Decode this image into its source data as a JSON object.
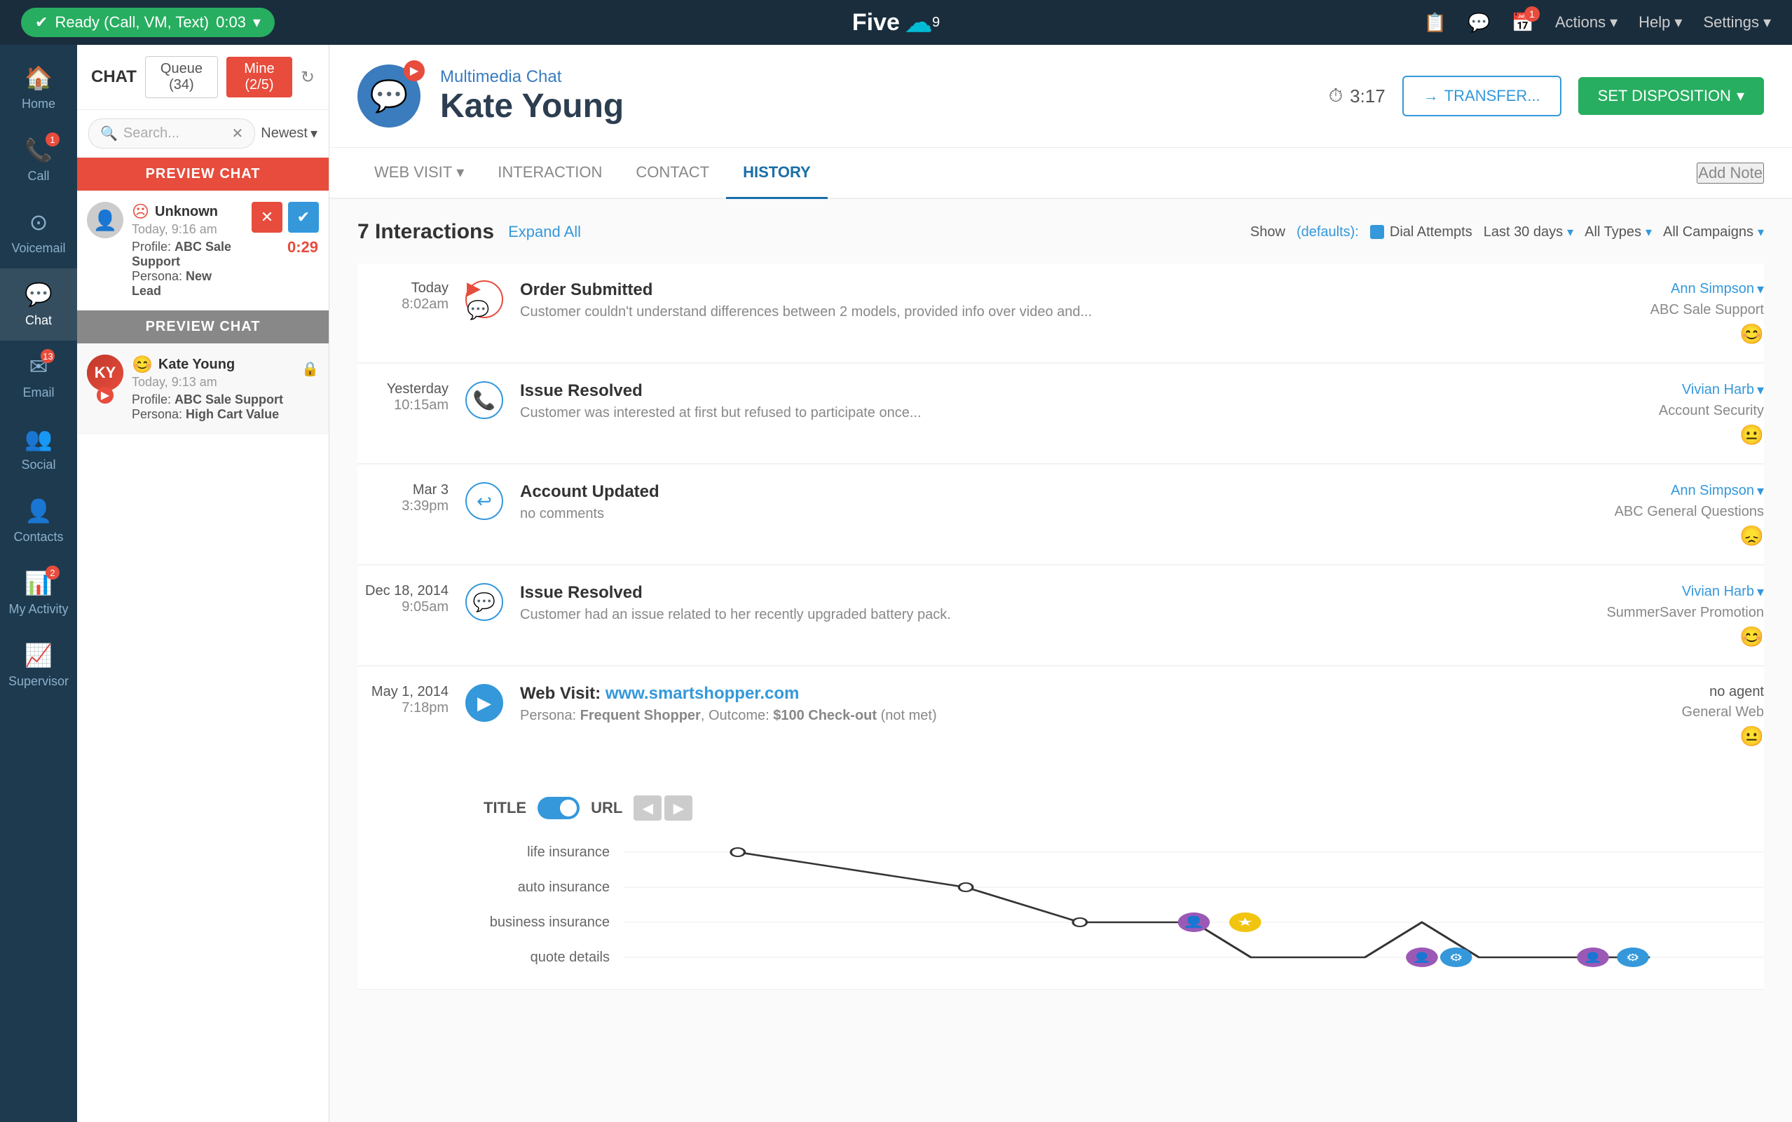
{
  "topNav": {
    "status": "Ready (Call, VM, Text)",
    "timer": "0:03",
    "logoText": "Five",
    "actions": "Actions",
    "help": "Help",
    "settings": "Settings",
    "notifBadge": "1"
  },
  "sidebar": {
    "items": [
      {
        "id": "home",
        "label": "Home",
        "icon": "🏠",
        "badge": null
      },
      {
        "id": "call",
        "label": "Call",
        "icon": "📞",
        "badge": "1"
      },
      {
        "id": "voicemail",
        "label": "Voicemail",
        "icon": "📧",
        "badge": null
      },
      {
        "id": "chat",
        "label": "Chat",
        "icon": "💬",
        "badge": null,
        "active": true
      },
      {
        "id": "email",
        "label": "Email",
        "icon": "✉️",
        "badge": "13"
      },
      {
        "id": "social",
        "label": "Social",
        "icon": "👥",
        "badge": null
      },
      {
        "id": "contacts",
        "label": "Contacts",
        "icon": "📋",
        "badge": null
      },
      {
        "id": "my-activity",
        "label": "My Activity",
        "icon": "📊",
        "badge": "2"
      },
      {
        "id": "supervisor",
        "label": "Supervisor",
        "icon": "📈",
        "badge": null
      }
    ]
  },
  "chatPanel": {
    "title": "CHAT",
    "queueLabel": "Queue (34)",
    "mineLabel": "Mine (2/5)",
    "searchPlaceholder": "Search...",
    "newestLabel": "Newest",
    "previewChats": [
      {
        "id": "1",
        "headerLabel": "PREVIEW CHAT",
        "headerColor": "red",
        "name": "Unknown",
        "time": "Today, 9:16 am",
        "profile": "ABC Sale Support",
        "persona": "New Lead",
        "timer": "0:29",
        "emotion": "unknown"
      },
      {
        "id": "2",
        "headerLabel": "PREVIEW CHAT",
        "headerColor": "gray",
        "name": "Kate Young",
        "time": "Today, 9:13 am",
        "profile": "ABC Sale Support",
        "persona": "High Cart Value",
        "hasVideo": true,
        "hasLock": true
      }
    ]
  },
  "contactHeader": {
    "type": "Multimedia Chat",
    "name": "Kate Young",
    "timer": "3:17",
    "transferLabel": "TRANSFER...",
    "setDispositionLabel": "SET DISPOSITION"
  },
  "tabs": {
    "items": [
      {
        "id": "web-visit",
        "label": "WEB VISIT",
        "hasDropdown": true
      },
      {
        "id": "interaction",
        "label": "INTERACTION",
        "hasDropdown": false
      },
      {
        "id": "contact",
        "label": "CONTACT",
        "hasDropdown": false
      },
      {
        "id": "history",
        "label": "HISTORY",
        "hasDropdown": false,
        "active": true
      }
    ],
    "addNoteLabel": "Add Note"
  },
  "history": {
    "interactionsCount": "7 Interactions",
    "expandAllLabel": "Expand All",
    "showLabel": "Show",
    "defaultsLabel": "(defaults):",
    "dialAttemptsLabel": "Dial Attempts",
    "lastDaysLabel": "Last 30 days",
    "allTypesLabel": "All Types",
    "allCampaignsLabel": "All Campaigns",
    "interactions": [
      {
        "date": "Today",
        "time": "8:02am",
        "icon": "💬",
        "iconType": "video",
        "title": "Order Submitted",
        "desc": "Customer couldn't understand differences between 2 models, provided info over video and...",
        "agent": "Ann Simpson",
        "campaign": "ABC Sale Support",
        "sentiment": "happy"
      },
      {
        "date": "Yesterday",
        "time": "10:15am",
        "icon": "📞",
        "iconType": "call",
        "title": "Issue Resolved",
        "desc": "Customer was interested at first but refused to participate once...",
        "agent": "Vivian Harb",
        "campaign": "Account Security",
        "sentiment": "neutral"
      },
      {
        "date": "Mar 3",
        "time": "3:39pm",
        "icon": "↩",
        "iconType": "transfer",
        "title": "Account Updated",
        "desc": "no comments",
        "agent": "Ann Simpson",
        "campaign": "ABC General Questions",
        "sentiment": "sad"
      },
      {
        "date": "Dec 18, 2014",
        "time": "9:05am",
        "icon": "💬",
        "iconType": "chat",
        "title": "Issue Resolved",
        "desc": "Customer had an issue related to her recently upgraded battery pack.",
        "agent": "Vivian Harb",
        "campaign": "SummerSaver Promotion",
        "sentiment": "happy"
      },
      {
        "date": "May 1, 2014",
        "time": "7:18pm",
        "icon": "▶",
        "iconType": "web",
        "title": "Web Visit",
        "url": "www.smartshopper.com",
        "persona": "Frequent Shopper",
        "outcome": "$100 Check-out",
        "outcomeMet": false,
        "agent": "no agent",
        "campaign": "General Web",
        "sentiment": "neutral"
      }
    ],
    "webVisit": {
      "titleLabel": "TITLE",
      "urlLabel": "URL",
      "journeyRows": [
        {
          "label": "life insurance"
        },
        {
          "label": "auto insurance"
        },
        {
          "label": "business insurance"
        },
        {
          "label": "quote details"
        }
      ]
    }
  }
}
